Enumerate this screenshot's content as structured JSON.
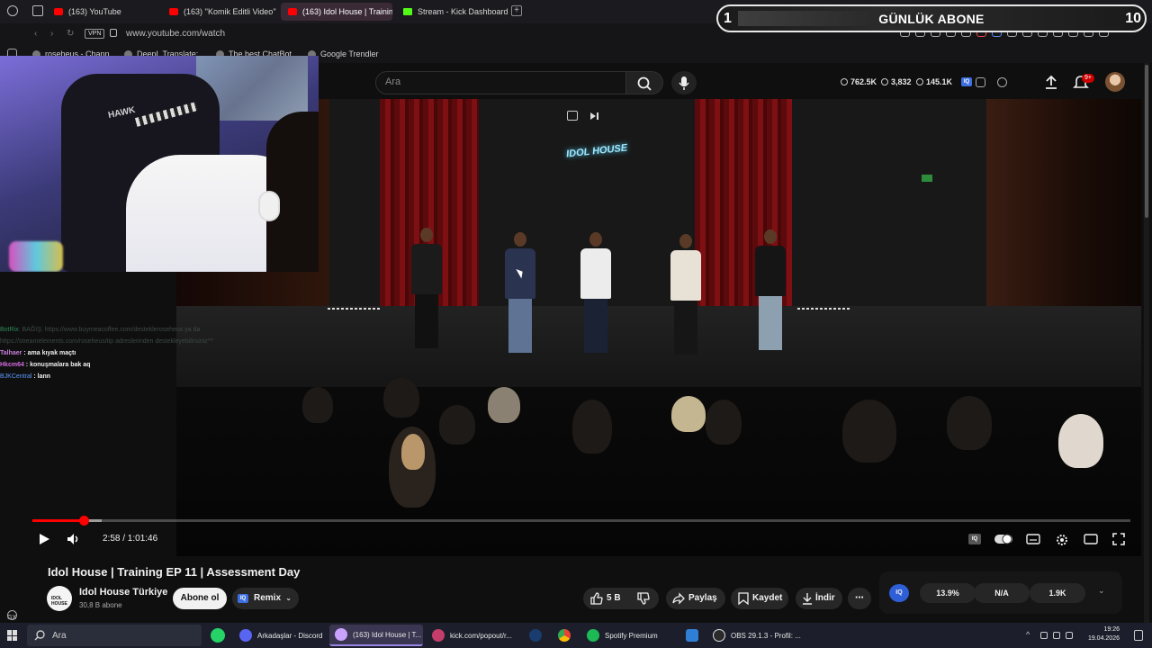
{
  "browser": {
    "tabs": [
      {
        "label": "(163) YouTube",
        "type": "youtube"
      },
      {
        "label": "(163) ''Komik Editli Video''",
        "type": "youtube"
      },
      {
        "label": "(163) Idol House | Training",
        "type": "youtube",
        "active": true
      },
      {
        "label": "Stream - Kick Dashboard",
        "type": "kick"
      }
    ],
    "vpn_label": "VPN",
    "url": "www.youtube.com/watch",
    "bookmarks": [
      "roseheus - Chann...",
      "DeepL Translate:",
      "The best ChatBot",
      "Google Trendler"
    ]
  },
  "overlay": {
    "counter_left": "1",
    "title": "GÜNLÜK ABONE",
    "counter_right": "10"
  },
  "youtube_header": {
    "search_placeholder": "Ara",
    "stats": {
      "views": "762.5K",
      "eye": "3,832",
      "other": "145.1K"
    },
    "iq_label": "IQ",
    "notification_count": "9+"
  },
  "webcam": {
    "chair_text": "HAWK"
  },
  "chat": [
    {
      "user": "BotRix",
      "text": "BAĞIŞ: https://www.buymeacoffee.com/destekleroseheus ya da https://streamelements.com/roseheus/tip adreslerinden destekleyebilirsiniz^^",
      "style": "faded"
    },
    {
      "user": "Talhaer",
      "text": "ama kıyak maçtı"
    },
    {
      "user": "Hkcm64",
      "text": "konuşmalara bak aq"
    },
    {
      "user": "BJKCentral",
      "text": "lann"
    }
  ],
  "video": {
    "neon_logo": "IDOL HOUSE",
    "progress": 0.047,
    "buffered": 0.063,
    "current_time": "2:58",
    "duration": "1:01:46",
    "time_display": "2:58 / 1:01:46"
  },
  "info": {
    "title": "Idol House | Training EP 11 | Assessment Day",
    "channel_name": "Idol House Türkiye",
    "channel_avatar_text": "IDOL HOUSE",
    "subscribers": "30,8 B abone",
    "subscribe_label": "Abone ol",
    "remix_label": "Remix",
    "like_count": "5 B",
    "share_label": "Paylaş",
    "save_label": "Kaydet",
    "download_label": "İndir",
    "iq_stats": [
      "13.9%",
      "N/A",
      "1.9K"
    ]
  },
  "taskbar": {
    "search_placeholder": "Ara",
    "items": [
      {
        "label": "Arkadaşlar - Discord",
        "color": "#5865f2"
      },
      {
        "label": "(163) Idol House | T...",
        "color": "#c9a2ff",
        "active": true
      },
      {
        "label": "kick.com/popout/r...",
        "color": "#c43d6b"
      },
      {
        "label": "Spotify Premium",
        "color": "#1db954"
      },
      {
        "label": "OBS 29.1.3 - Profil: ...",
        "color": "#dcdcdc"
      }
    ],
    "time": "19:26",
    "date": "19.04.2026"
  },
  "left_rail": {
    "label": "GX"
  }
}
